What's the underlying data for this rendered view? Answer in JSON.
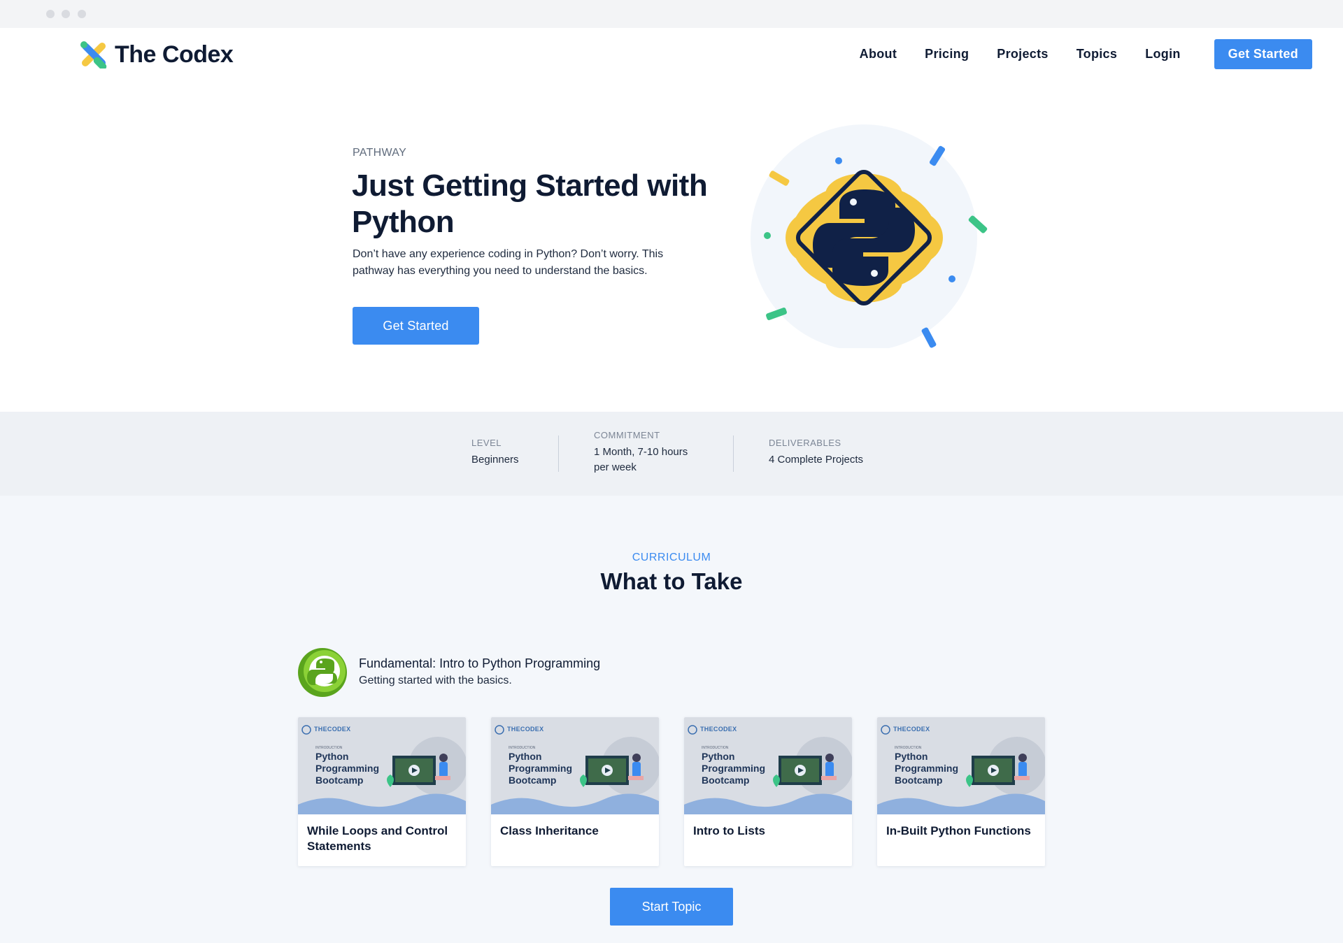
{
  "header": {
    "brand": "The Codex",
    "nav": [
      "About",
      "Pricing",
      "Projects",
      "Topics",
      "Login"
    ],
    "cta_label": "Get Started"
  },
  "hero": {
    "eyebrow": "PATHWAY",
    "title": "Just Getting Started with Python",
    "description": "Don’t have any experience coding in Python? Don’t worry. This pathway has everything you need to understand the basics.",
    "button_label": "Get Started"
  },
  "stats": [
    {
      "label": "LEVEL",
      "value": "Beginners"
    },
    {
      "label": "COMMITMENT",
      "value": "1 Month, 7-10 hours per week"
    },
    {
      "label": "DELIVERABLES",
      "value": "4 Complete Projects"
    }
  ],
  "curriculum": {
    "eyebrow": "CURRICULUM",
    "title": "What to Take",
    "topic_name": "Fundamental: Intro to Python Programming",
    "topic_subtitle": "Getting started with the basics.",
    "thumb": {
      "brand": "THECODEX",
      "intro": "INTRODUCTION",
      "title": "Python Programming Bootcamp"
    },
    "cards": [
      {
        "title": "While Loops and Control Statements"
      },
      {
        "title": "Class Inheritance"
      },
      {
        "title": "Intro to Lists"
      },
      {
        "title": "In-Built Python Functions"
      }
    ],
    "start_label": "Start Topic"
  },
  "colors": {
    "accent": "#3b8bf0",
    "navy": "#0f1b33",
    "python_yellow": "#f5c842",
    "green": "#3cc487"
  }
}
